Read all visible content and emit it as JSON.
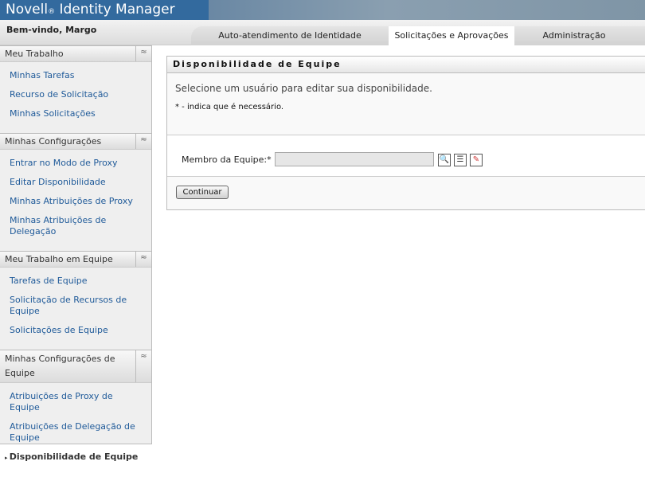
{
  "header": {
    "brand": "Novell",
    "brand_mark": "®",
    "product": "Identity Manager",
    "welcome": "Bem-vindo, Margo"
  },
  "tabs": [
    {
      "label": "Auto-atendimento de Identidade"
    },
    {
      "label": "Solicitações e Aprovações",
      "active": true
    },
    {
      "label": "Administração"
    }
  ],
  "sidebar": {
    "sections": [
      {
        "title": "Meu Trabalho",
        "items": [
          "Minhas Tarefas",
          "Recurso de Solicitação",
          "Minhas Solicitações"
        ]
      },
      {
        "title": "Minhas Configurações",
        "items": [
          "Entrar no Modo de Proxy",
          "Editar Disponibilidade",
          "Minhas Atribuições de Proxy",
          "Minhas Atribuições de Delegação"
        ]
      },
      {
        "title": "Meu Trabalho em Equipe",
        "items": [
          "Tarefas de Equipe",
          "Solicitação de Recursos de Equipe",
          "Solicitações de Equipe"
        ]
      },
      {
        "title": "Minhas Configurações de Equipe",
        "items": [
          "Atribuições de Proxy de Equipe",
          "Atribuições de Delegação de Equipe",
          "Disponibilidade de Equipe"
        ]
      }
    ],
    "collapse_glyph": "≈"
  },
  "panel": {
    "title": "Disponibilidade de Equipe",
    "intro": "Selecione um usuário para editar sua disponibilidade.",
    "required_note": "* - indica que é necessário.",
    "field_label": "Membro da Equipe:*",
    "field_value": "",
    "continue_label": "Continuar"
  }
}
